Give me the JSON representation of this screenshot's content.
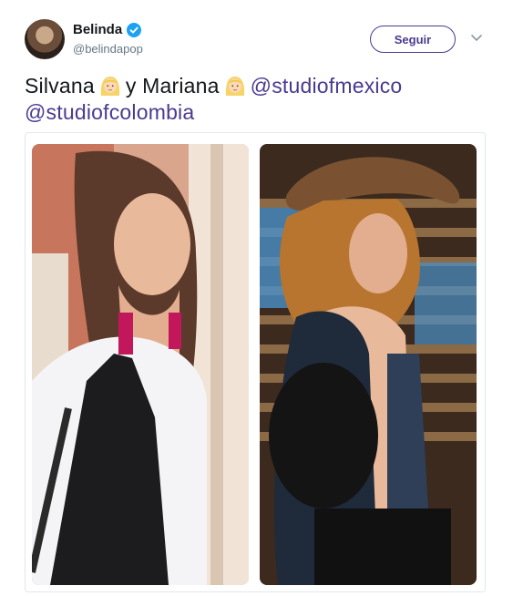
{
  "author": {
    "name": "Belinda",
    "handle": "@belindapop",
    "verified_icon": "verified-badge-icon",
    "avatar": "avatar"
  },
  "actions": {
    "follow_label": "Seguir",
    "menu_icon": "chevron-down-icon"
  },
  "tweet": {
    "text_1": "Silvana",
    "emoji_1": "blond-woman-emoji",
    "text_2": "y Mariana",
    "emoji_2": "blond-woman-emoji",
    "mention_1": "@studiofmexico",
    "mention_2": "@studiofcolombia"
  },
  "media": [
    {
      "name": "photo-woman-straight-hair"
    },
    {
      "name": "photo-woman-cowboy-hat"
    }
  ],
  "colors": {
    "accent": "#4a3a8f",
    "verified": "#1da1f2",
    "text": "#14171a",
    "secondary": "#657786"
  }
}
